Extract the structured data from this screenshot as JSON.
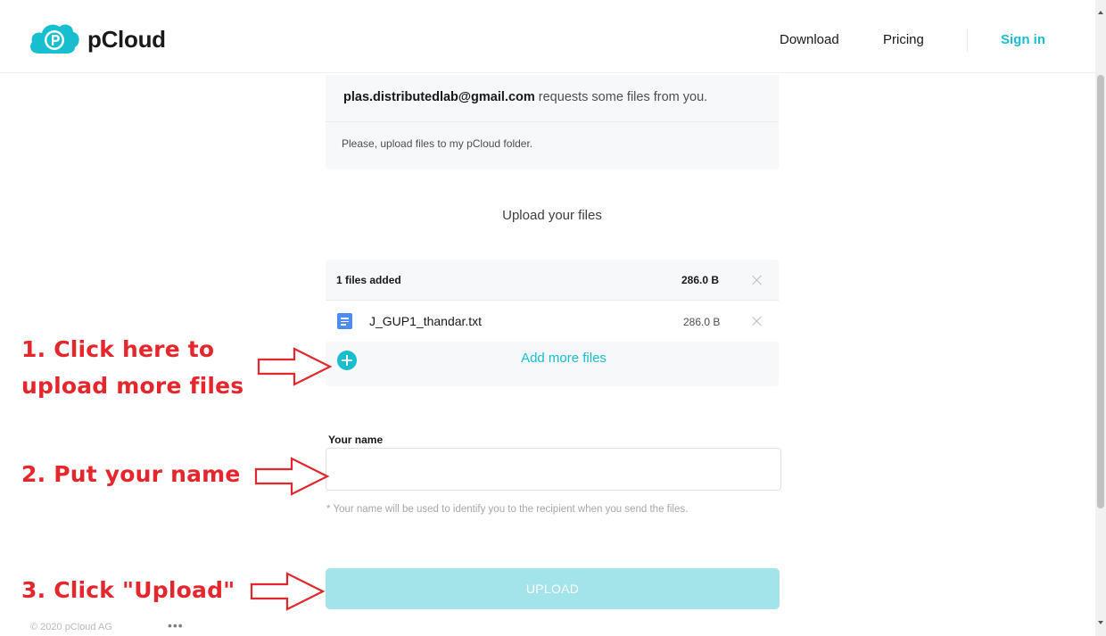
{
  "header": {
    "brand": "pCloud",
    "nav": {
      "download": "Download",
      "pricing": "Pricing",
      "sign_in": "Sign in"
    }
  },
  "request": {
    "email": "plas.distributedlab@gmail.com",
    "suffix": " requests some files from you.",
    "message": "Please, upload files to my pCloud folder."
  },
  "upload_section": {
    "title": "Upload your files"
  },
  "files": {
    "count_label": "1 files added",
    "total_size": "286.0 B",
    "items": [
      {
        "name": "J_GUP1_thandar.txt",
        "size": "286.0 B"
      }
    ],
    "add_more": "Add more files"
  },
  "name_field": {
    "label": "Your name",
    "value": "",
    "hint": "* Your name will be used to identify you to the recipient when you send the files."
  },
  "upload_button": "UPLOAD",
  "footer": {
    "copyright": "© 2020 pCloud AG",
    "more": "•••"
  },
  "annotations": {
    "step1_line1": "1. Click here to",
    "step1_line2": "upload more files",
    "step2": "2. Put your name",
    "step3": "3. Click \"Upload\""
  },
  "colors": {
    "brand": "#17bed0",
    "annotation": "#e5262c",
    "file_icon": "#4d8bf5"
  }
}
